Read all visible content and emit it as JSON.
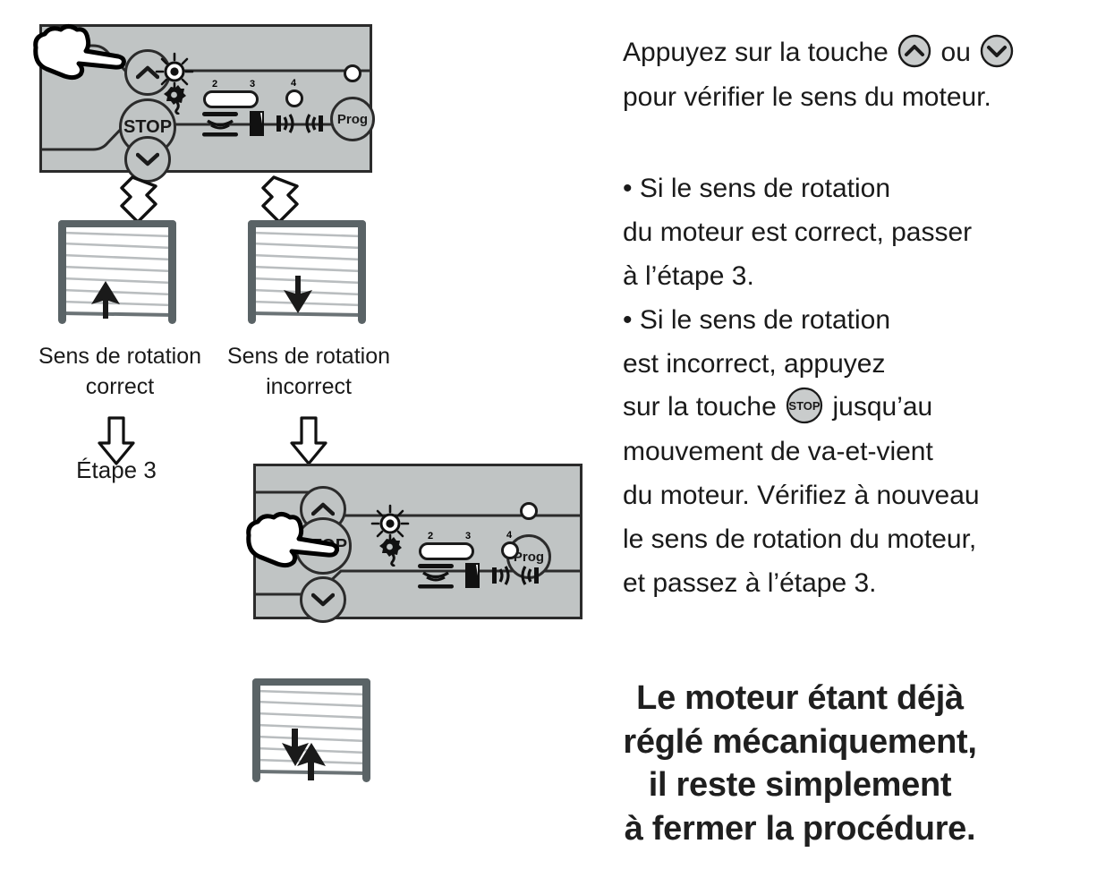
{
  "panels": {
    "top": {
      "up_button_label": "",
      "stop_button_label": "STOP",
      "down_button_label": "",
      "prog_button_label": "Prog",
      "led_numbers": [
        "2",
        "3",
        "4"
      ]
    },
    "bottom": {
      "up_button_label": "",
      "stop_button_label": "STOP",
      "down_button_label": "",
      "prog_button_label": "Prog",
      "led_numbers": [
        "2",
        "3",
        "4"
      ]
    }
  },
  "captions": {
    "correct_line1": "Sens de rotation",
    "correct_line2": "correct",
    "incorrect_line1": "Sens de rotation",
    "incorrect_line2": "incorrect",
    "step3": "Étape 3"
  },
  "instructions": {
    "line1_part1": "Appuyez sur la touche",
    "line1_part2": "ou",
    "line2": "pour vérifier le sens du moteur.",
    "bullet1_line1": "• Si le sens de rotation",
    "bullet1_line2": "du moteur est correct, passer",
    "bullet1_line3": "à l’étape 3.",
    "bullet2_line1": "• Si le sens de rotation",
    "bullet2_line2": "est incorrect, appuyez",
    "bullet2_line3_part1": "sur la touche",
    "bullet2_line3_key": "STOP",
    "bullet2_line3_part2": "jusqu’au",
    "bullet2_line4": "mouvement de va-et-vient",
    "bullet2_line5": "du moteur. Vérifiez à nouveau",
    "bullet2_line6": "le sens de rotation du moteur,",
    "bullet2_line7": "et passez à l’étape 3."
  },
  "conclusion": {
    "line1": "Le moteur étant déjà",
    "line2": "réglé mécaniquement,",
    "line3": "il reste simplement",
    "line4": "à fermer la procédure."
  },
  "colors": {
    "panel_fill": "#c0c4c4",
    "panel_outline": "#2b2b2b",
    "frame": "#5a6366",
    "slat": "#b8bcbe",
    "arrow_dark": "#1a1a1a",
    "text": "#1a1a1a"
  }
}
